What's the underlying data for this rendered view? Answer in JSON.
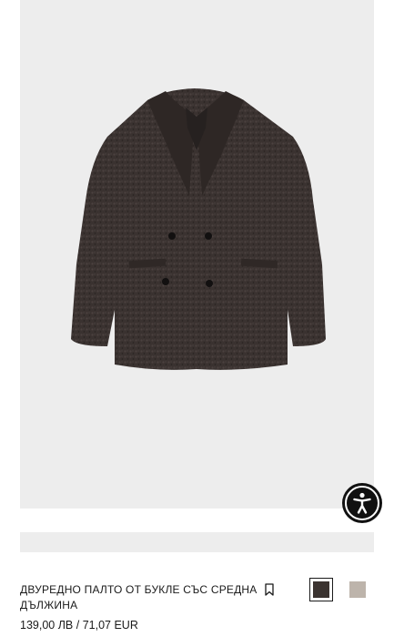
{
  "product": {
    "name": "ДВУРЕДНО ПАЛТО ОТ БУКЛЕ СЪС СРЕДНА ДЪЛЖИНА",
    "price_bgn": "139,00 ЛВ",
    "price_separator": "/",
    "price_eur": "71,07 EUR"
  },
  "colors": {
    "image_background": "#ededed",
    "coat": "#3a3230",
    "swatch_dark": "#3b3330",
    "swatch_beige": "#bdb4ab",
    "accessibility_button": "#111111"
  },
  "icons": {
    "accessibility": "accessibility-person-icon",
    "save": "bookmark-icon"
  },
  "swatches": [
    {
      "name": "dark-brown",
      "selected": true
    },
    {
      "name": "beige",
      "selected": false
    }
  ]
}
